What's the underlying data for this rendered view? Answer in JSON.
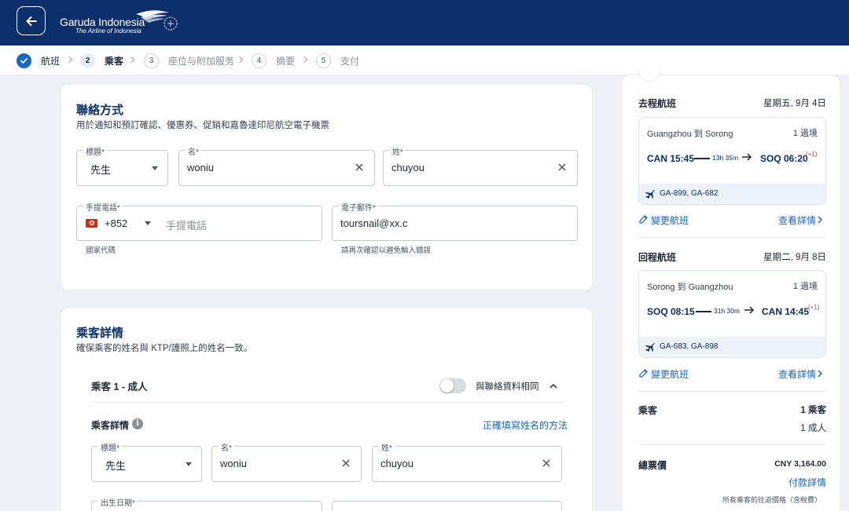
{
  "header": {
    "brand_name": "Garuda Indonesia",
    "brand_tagline": "The Airline of Indonesia",
    "back_icon": "arrow-left-icon",
    "colors": {
      "navy": "#0a2f6b",
      "accent_blue": "#1668c7",
      "plus_day": "#c24a3a"
    }
  },
  "stepper": {
    "steps": [
      {
        "number": "✓",
        "label": "航班",
        "state": "done"
      },
      {
        "number": "2",
        "label": "乘客",
        "state": "active"
      },
      {
        "number": "3",
        "label": "座位与附加服务",
        "state": "upcoming"
      },
      {
        "number": "4",
        "label": "摘要",
        "state": "upcoming"
      },
      {
        "number": "5",
        "label": "支付",
        "state": "upcoming"
      }
    ]
  },
  "contact": {
    "title": "聯絡方式",
    "subtitle": "用於通知和預訂確認、優惠券、促銷和嘉魯達印尼航空電子機票",
    "salutation": {
      "label": "標題",
      "required": "*",
      "value": "先生"
    },
    "first_name": {
      "label": "名",
      "required": "*",
      "value": "woniu"
    },
    "last_name": {
      "label": "姓",
      "required": "*",
      "value": "chuyou"
    },
    "phone": {
      "label": "手提電話",
      "required": "*",
      "country_code": "+852",
      "placeholder": "手提電話",
      "helper": "國家代碼"
    },
    "email": {
      "label": "電子郵件",
      "required": "*",
      "value": "toursnail@xx.c",
      "helper": "請再次確認以避免輸入錯誤"
    }
  },
  "passengers": {
    "title": "乘客詳情",
    "subtitle": "確保乘客的姓名與 KTP/護照上的姓名一致。",
    "passenger1": {
      "heading": "乘客 1 - 成人",
      "same_as_contact_label": "與聯絡資料相同",
      "same_as_contact": false,
      "details_label": "乘客詳情",
      "name_help_link": "正確填寫姓名的方法",
      "salutation": {
        "label": "標題",
        "required": "*",
        "value": "先生"
      },
      "first_name": {
        "label": "名",
        "required": "*",
        "value": "woniu"
      },
      "last_name": {
        "label": "姓",
        "required": "*",
        "value": "chuyou"
      },
      "dob": {
        "label": "出生日期",
        "required": "*"
      }
    }
  },
  "summary": {
    "outbound": {
      "heading": "去程航班",
      "date": "星期五, 9月 4日",
      "route": "Guangzhou 到 Sorong",
      "stops": "1 過境",
      "dep": "CAN 15:45",
      "duration": "13h 35m",
      "arr": "SOQ 06:20",
      "plus_day": "(+1)",
      "flight_numbers": "GA-899, GA-682",
      "change_link": "變更航班",
      "details_link": "查看詳情"
    },
    "return": {
      "heading": "回程航班",
      "date": "星期二, 9月 8日",
      "route": "Sorong 到 Guangzhou",
      "stops": "1 過境",
      "dep": "SOQ 08:15",
      "duration": "31h 30m",
      "arr": "CAN 14:45",
      "plus_day": "(+1)",
      "flight_numbers": "GA-683, GA-898",
      "change_link": "變更航班",
      "details_link": "查看詳情"
    },
    "passengers": {
      "label": "乘客",
      "count": "1 乘客",
      "breakdown": "1 成人"
    },
    "total": {
      "label": "總票價",
      "amount": "CNY 3,164.00",
      "payment_link": "付款詳情",
      "note": "所有乘客的往返價格（含稅費）"
    }
  }
}
